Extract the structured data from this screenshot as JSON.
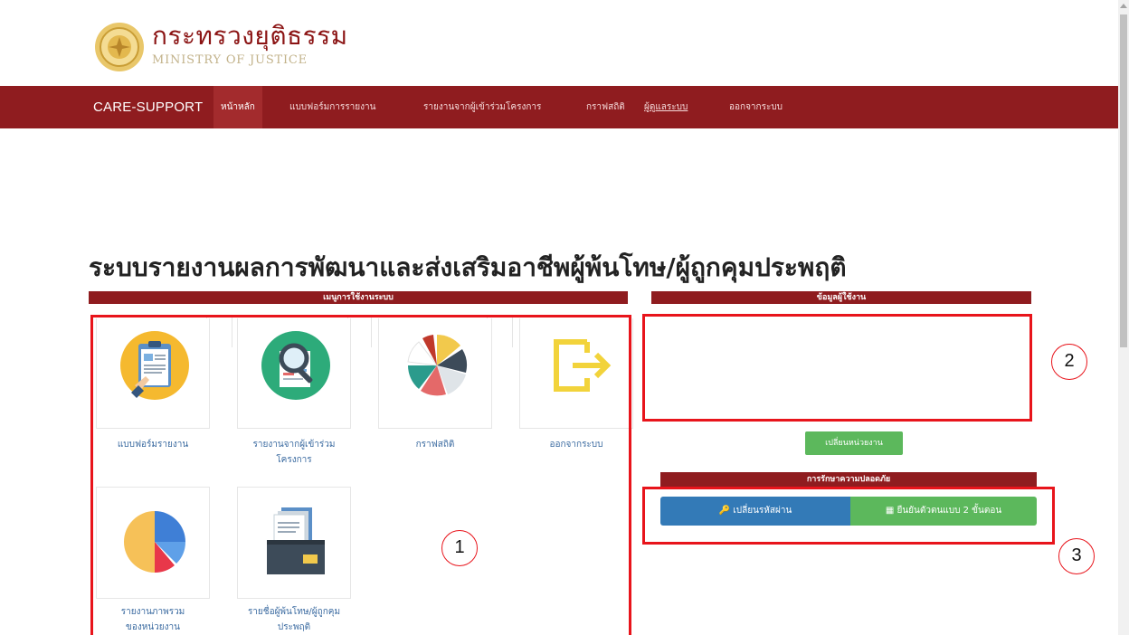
{
  "header": {
    "logo_thai": "กระทรวงยุติธรรม",
    "logo_english": "MINISTRY OF JUSTICE"
  },
  "navbar": {
    "brand": "CARE-SUPPORT",
    "items": [
      {
        "label": "หน้าหลัก",
        "active": true
      },
      {
        "label": "แบบฟอร์มการรายงาน"
      },
      {
        "label": "รายงานจากผู้เข้าร่วมโครงการ"
      },
      {
        "label": "กราฟสถิติ"
      },
      {
        "label": "ผู้ดูแลระบบ"
      },
      {
        "label": "ออกจากระบบ"
      }
    ]
  },
  "page_title": "ระบบรายงานผลการพัฒนาและส่งเสริมอาชีพผู้พ้นโทษ/ผู้ถูกคุมประพฤติ",
  "menu_section": {
    "title": "เมนูการใช้งานระบบ",
    "tiles": [
      {
        "label": "แบบฟอร์มรายงาน",
        "icon": "clipboard-form-icon"
      },
      {
        "label": "รายงานจากผู้เข้าร่วมโครงการ",
        "icon": "magnifier-report-icon"
      },
      {
        "label": "กราฟสถิติ",
        "icon": "pie-chart-icon"
      },
      {
        "label": "ออกจากระบบ",
        "icon": "logout-icon"
      },
      {
        "label": "รายงานภาพรวมของหน่วยงาน",
        "icon": "overview-pie-icon"
      },
      {
        "label": "รายชื่อผู้พ้นโทษ/ผู้ถูกคุมประพฤติ",
        "icon": "document-tray-icon"
      }
    ]
  },
  "user_section": {
    "title": "ข้อมูลผู้ใช้งาน",
    "change_unit_button": "เปลี่ยนหน่วยงาน"
  },
  "security_section": {
    "title": "การรักษาความปลอดภัย",
    "change_password_button": "เปลี่ยนรหัสผ่าน",
    "two_factor_button": "ยืนยันตัวตนแบบ 2 ขั้นตอน"
  },
  "annotations": {
    "box1_number": "1",
    "box2_number": "2",
    "box3_number": "3"
  },
  "colors": {
    "navbar": "#8f1c1f",
    "primary_button": "#337ab7",
    "success_button": "#5cb85c",
    "annotation_red": "#e8141b"
  }
}
